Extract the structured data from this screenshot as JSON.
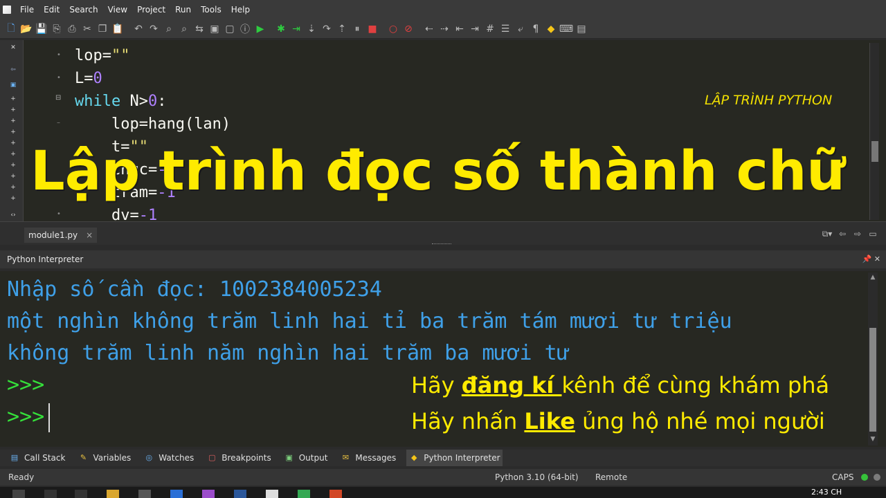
{
  "menu": {
    "items": [
      "File",
      "Edit",
      "Search",
      "View",
      "Project",
      "Run",
      "Tools",
      "Help"
    ]
  },
  "toolbar": {
    "icons": [
      "new-file-icon",
      "open-icon",
      "save-icon",
      "save-all-icon",
      "print-icon",
      "cut-icon",
      "copy-icon",
      "paste-icon",
      "undo-icon",
      "redo-icon",
      "find-icon",
      "find-in-files-icon",
      "replace-icon",
      "goto-icon",
      "select-icon",
      "info-icon",
      "run-icon",
      "debug-icon",
      "step-into-icon",
      "step-over-icon",
      "step-out-icon",
      "step-up-icon",
      "pause-icon",
      "stop-icon",
      "breakpoint-icon",
      "clear-breakpoints-icon",
      "back-icon",
      "forward-icon",
      "indent-icon",
      "dedent-icon",
      "comment-icon",
      "list-icon",
      "wrap-icon",
      "paragraph-icon",
      "python-icon",
      "keyboard-icon",
      "layout-icon"
    ]
  },
  "editor": {
    "corner_label": "LẬP TRÌNH PYTHON",
    "lines": [
      {
        "indent": "",
        "parts": [
          {
            "t": "lop=",
            "c": "plain"
          },
          {
            "t": "\"\"",
            "c": "str"
          }
        ]
      },
      {
        "indent": "",
        "parts": [
          {
            "t": "L=",
            "c": "plain"
          },
          {
            "t": "0",
            "c": "num"
          }
        ]
      },
      {
        "indent": "",
        "parts": [
          {
            "t": "while",
            "c": "kw"
          },
          {
            "t": " N>",
            "c": "plain"
          },
          {
            "t": "0",
            "c": "num"
          },
          {
            "t": ":",
            "c": "plain"
          }
        ]
      },
      {
        "indent": "    ",
        "parts": [
          {
            "t": "lop=hang(lan)",
            "c": "plain"
          }
        ]
      },
      {
        "indent": "    ",
        "parts": [
          {
            "t": "t=",
            "c": "plain"
          },
          {
            "t": "\"\"",
            "c": "str"
          }
        ]
      },
      {
        "indent": "    ",
        "parts": [
          {
            "t": "chuc=",
            "c": "plain"
          },
          {
            "t": "-1",
            "c": "num"
          }
        ]
      },
      {
        "indent": "    ",
        "parts": [
          {
            "t": "tram=",
            "c": "plain"
          },
          {
            "t": "-1",
            "c": "num"
          }
        ]
      },
      {
        "indent": "    ",
        "parts": [
          {
            "t": "dv=",
            "c": "plain"
          },
          {
            "t": "-1",
            "c": "num"
          }
        ]
      }
    ]
  },
  "overlay": {
    "title": "Lập trình đọc số thành chữ"
  },
  "tabs": {
    "file_tab": "module1.py",
    "close_glyph": "×"
  },
  "interpreter": {
    "header": "Python Interpreter",
    "lines": [
      "Nhập số cần đọc: 1002384005234",
      "một nghìn không trăm linh hai tỉ ba trăm tám mươi tư triệu",
      "không trăm linh năm nghìn hai trăm ba mươi tư"
    ],
    "prompts": [
      ">>>",
      ">>>"
    ],
    "promo": {
      "line1_pre": "Hãy ",
      "line1_u": "đăng kí ",
      "line1_post": "kênh  để cùng khám phá",
      "line2_pre": "Hãy nhấn ",
      "line2_u": "Like",
      "line2_post": " ủng hộ nhé mọi người"
    }
  },
  "panel_tabs": [
    {
      "label": "Call Stack",
      "icon": "call-stack-icon"
    },
    {
      "label": "Variables",
      "icon": "variables-icon"
    },
    {
      "label": "Watches",
      "icon": "watches-icon"
    },
    {
      "label": "Breakpoints",
      "icon": "breakpoints-icon"
    },
    {
      "label": "Output",
      "icon": "output-icon"
    },
    {
      "label": "Messages",
      "icon": "messages-icon"
    },
    {
      "label": "Python Interpreter",
      "icon": "python-icon"
    }
  ],
  "status": {
    "left": "Ready",
    "python": "Python 3.10 (64-bit)",
    "remote": "Remote",
    "caps": "CAPS"
  },
  "taskbar": {
    "clock": "2:43 CH"
  },
  "colors": {
    "accent_yellow": "#ffeb00",
    "console_blue": "#3fa0e8",
    "prompt_green": "#35e03a"
  }
}
